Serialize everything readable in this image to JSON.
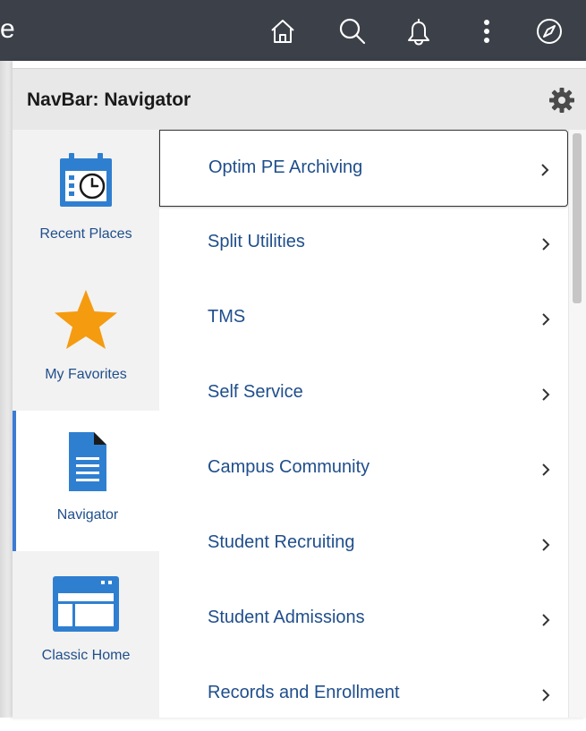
{
  "topbar": {
    "edge_text": "e",
    "icons": [
      "home-icon",
      "search-icon",
      "bell-icon",
      "more-vertical-icon",
      "compass-icon"
    ],
    "color": "#3c4048"
  },
  "panel": {
    "title": "NavBar: Navigator",
    "settings_icon": "gear-icon"
  },
  "rail": {
    "items": [
      {
        "label": "Recent Places",
        "icon": "calendar-clock-icon",
        "active": false
      },
      {
        "label": "My Favorites",
        "icon": "star-icon",
        "active": false
      },
      {
        "label": "Navigator",
        "icon": "document-icon",
        "active": true
      },
      {
        "label": "Classic Home",
        "icon": "browser-window-icon",
        "active": false
      }
    ]
  },
  "list": {
    "items": [
      {
        "label": "Optim PE Archiving",
        "selected": true
      },
      {
        "label": "Split Utilities",
        "selected": false
      },
      {
        "label": "TMS",
        "selected": false
      },
      {
        "label": "Self Service",
        "selected": false
      },
      {
        "label": "Campus Community",
        "selected": false
      },
      {
        "label": "Student Recruiting",
        "selected": false
      },
      {
        "label": "Student Admissions",
        "selected": false
      },
      {
        "label": "Records and Enrollment",
        "selected": false
      }
    ]
  },
  "colors": {
    "link": "#1f4e8c",
    "accent_blue": "#2f7fd1",
    "star": "#f59b10",
    "active_border": "#3a7bd5"
  }
}
